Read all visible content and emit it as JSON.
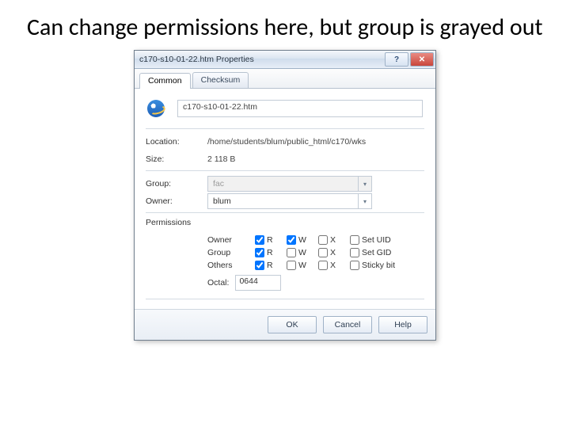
{
  "slide": {
    "title": "Can change permissions here, but group is grayed out"
  },
  "dialog": {
    "titlebar": "c170-s10-01-22.htm Properties",
    "tabs": [
      "Common",
      "Checksum"
    ],
    "file_name": "c170-s10-01-22.htm",
    "fields": {
      "location_label": "Location:",
      "location_value": "/home/students/blum/public_html/c170/wks",
      "size_label": "Size:",
      "size_value": "2 118 B",
      "group_label": "Group:",
      "group_value": "fac",
      "owner_label": "Owner:",
      "owner_value": "blum",
      "permissions_label": "Permissions",
      "octal_label": "Octal:",
      "octal_value": "0644"
    },
    "perm": {
      "rows": [
        "Owner",
        "Group",
        "Others"
      ],
      "cols": [
        "R",
        "W",
        "X"
      ],
      "extras": [
        "Set UID",
        "Set GID",
        "Sticky bit"
      ],
      "grid": [
        [
          true,
          true,
          false,
          false
        ],
        [
          true,
          false,
          false,
          false
        ],
        [
          true,
          false,
          false,
          false
        ]
      ]
    },
    "buttons": {
      "ok": "OK",
      "cancel": "Cancel",
      "help": "Help"
    }
  }
}
